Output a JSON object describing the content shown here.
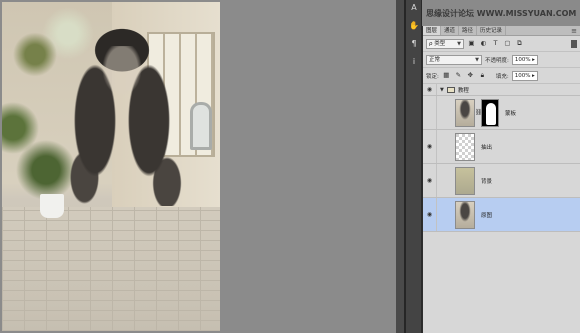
{
  "watermark": "思缘设计论坛 WWW.MISSYUAN.COM",
  "tools": [
    "A",
    "✋",
    "¶",
    "i"
  ],
  "panel": {
    "tabs": [
      "图层",
      "通道",
      "路径",
      "历史记录"
    ],
    "menu_icon": "≡",
    "filter_select": "ρ 类型",
    "blend_mode": "正常",
    "opacity_label": "不透明度:",
    "opacity_value": "100%",
    "lock_label": "锁定:",
    "fill_label": "填充:",
    "fill_value": "100%"
  },
  "layers": [
    {
      "name": "教程",
      "type": "group",
      "visible": true
    },
    {
      "name": "蒙板",
      "type": "masked",
      "visible": false
    },
    {
      "name": "抽出",
      "type": "transparent",
      "visible": true
    },
    {
      "name": "背景",
      "type": "background",
      "visible": true
    },
    {
      "name": "原图",
      "type": "photo",
      "visible": true,
      "selected": true
    }
  ]
}
